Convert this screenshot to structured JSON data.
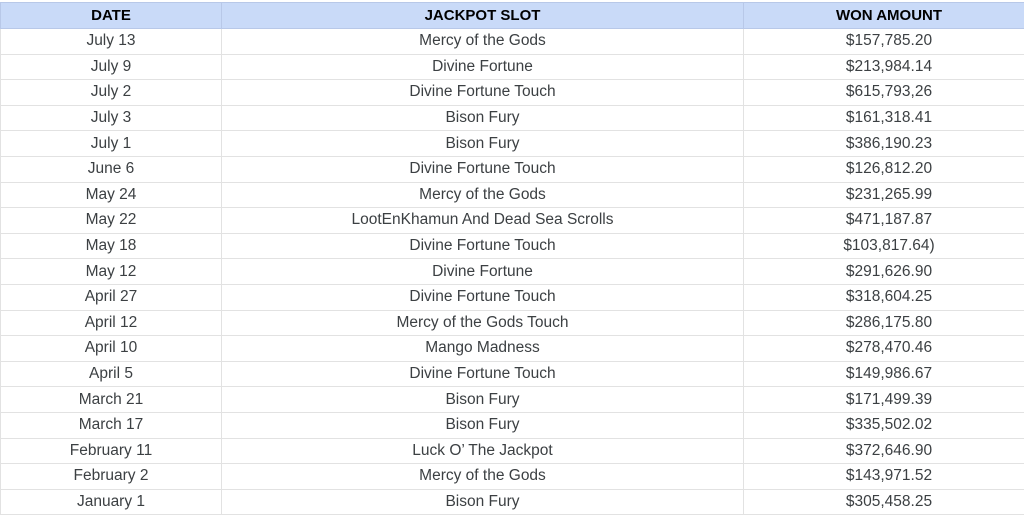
{
  "table": {
    "headers": {
      "date": "DATE",
      "slot": "JACKPOT SLOT",
      "amount": "WON AMOUNT"
    },
    "colors": {
      "header_bg": "#c9daf8",
      "text": "#3c4043",
      "grid": "#e2e2e2"
    },
    "rows": [
      {
        "date": "July 13",
        "slot": "Mercy of the Gods",
        "amount": "$157,785.20"
      },
      {
        "date": "July 9",
        "slot": "Divine Fortune",
        "amount": "$213,984.14"
      },
      {
        "date": "July 2",
        "slot": "Divine Fortune Touch",
        "amount": "$615,793,26"
      },
      {
        "date": "July 3",
        "slot": "Bison Fury",
        "amount": "$161,318.41"
      },
      {
        "date": "July 1",
        "slot": "Bison Fury",
        "amount": "$386,190.23"
      },
      {
        "date": "June 6",
        "slot": "Divine Fortune Touch",
        "amount": "$126,812.20"
      },
      {
        "date": "May 24",
        "slot": "Mercy of the Gods",
        "amount": "$231,265.99"
      },
      {
        "date": "May 22",
        "slot": "LootEnKhamun And Dead Sea Scrolls",
        "amount": "$471,187.87"
      },
      {
        "date": "May 18",
        "slot": "Divine Fortune Touch",
        "amount": "$103,817.64)"
      },
      {
        "date": "May 12",
        "slot": "Divine Fortune",
        "amount": "$291,626.90"
      },
      {
        "date": "April 27",
        "slot": "Divine Fortune Touch",
        "amount": "$318,604.25"
      },
      {
        "date": "April 12",
        "slot": "Mercy of the Gods Touch",
        "amount": "$286,175.80"
      },
      {
        "date": "April 10",
        "slot": "Mango Madness",
        "amount": "$278,470.46"
      },
      {
        "date": "April 5",
        "slot": "Divine Fortune Touch",
        "amount": "$149,986.67"
      },
      {
        "date": "March 21",
        "slot": "Bison Fury",
        "amount": "$171,499.39"
      },
      {
        "date": "March 17",
        "slot": "Bison Fury",
        "amount": "$335,502.02"
      },
      {
        "date": "February 11",
        "slot": "Luck O’ The Jackpot",
        "amount": "$372,646.90"
      },
      {
        "date": "February 2",
        "slot": "Mercy of the Gods",
        "amount": "$143,971.52"
      },
      {
        "date": "January 1",
        "slot": "Bison Fury",
        "amount": "$305,458.25"
      }
    ]
  }
}
